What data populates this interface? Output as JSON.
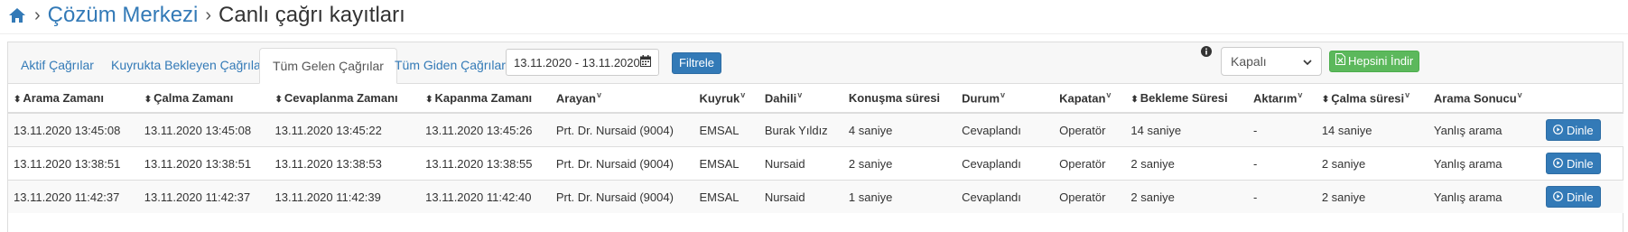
{
  "breadcrumb": {
    "home_icon": "home-icon",
    "link": "Çözüm Merkezi",
    "title": "Canlı çağrı kayıtları"
  },
  "tabs": [
    {
      "label": "Aktif Çağrılar"
    },
    {
      "label": "Kuyrukta Bekleyen Çağrılar"
    },
    {
      "label": "Tüm Gelen Çağrılar"
    },
    {
      "label": "Tüm Giden Çağrılar"
    }
  ],
  "active_tab": "Tüm Gelen Çağrılar",
  "date_range": {
    "value": "13.11.2020 - 13.11.2020"
  },
  "filter_button": "Filtrele",
  "select": {
    "value": "Kapalı"
  },
  "download_button": "Hepsini İndir",
  "columns": [
    {
      "label": "Arama Zamanı",
      "sort": true
    },
    {
      "label": "Çalma Zamanı",
      "sort": true
    },
    {
      "label": "Cevaplanma Zamanı",
      "sort": true
    },
    {
      "label": "Kapanma Zamanı",
      "sort": true
    },
    {
      "label": "Arayan",
      "filter": true
    },
    {
      "label": "Kuyruk",
      "filter": true
    },
    {
      "label": "Dahili",
      "filter": true
    },
    {
      "label": "Konuşma süresi"
    },
    {
      "label": "Durum",
      "filter": true
    },
    {
      "label": "Kapatan",
      "filter": true
    },
    {
      "label": "Bekleme Süresi",
      "sort": true
    },
    {
      "label": "Aktarım",
      "filter": true
    },
    {
      "label": "Çalma süresi",
      "sort": true,
      "filter": true
    },
    {
      "label": "Arama Sonucu",
      "filter": true
    },
    {
      "label": ""
    }
  ],
  "rows": [
    [
      "13.11.2020 13:45:08",
      "13.11.2020 13:45:08",
      "13.11.2020 13:45:22",
      "13.11.2020 13:45:26",
      "Prt. Dr. Nursaid (9004)",
      "EMSAL",
      "Burak Yıldız",
      "4 saniye",
      "Cevaplandı",
      "Operatör",
      "14 saniye",
      "-",
      "14 saniye",
      "Yanlış arama"
    ],
    [
      "13.11.2020 13:38:51",
      "13.11.2020 13:38:51",
      "13.11.2020 13:38:53",
      "13.11.2020 13:38:55",
      "Prt. Dr. Nursaid (9004)",
      "EMSAL",
      "Nursaid",
      "2 saniye",
      "Cevaplandı",
      "Operatör",
      "2 saniye",
      "-",
      "2 saniye",
      "Yanlış arama"
    ],
    [
      "13.11.2020 11:42:37",
      "13.11.2020 11:42:37",
      "13.11.2020 11:42:39",
      "13.11.2020 11:42:40",
      "Prt. Dr. Nursaid (9004)",
      "EMSAL",
      "Nursaid",
      "1 saniye",
      "Cevaplandı",
      "Operatör",
      "2 saniye",
      "-",
      "2 saniye",
      "Yanlış arama"
    ]
  ],
  "row_action": "Dinle",
  "icons": {
    "calendar": "calendar-icon",
    "info": "info-icon",
    "download": "excel-file-icon",
    "play": "play-circle-icon"
  },
  "colors": {
    "link": "#337ab7",
    "primary": "#337ab7",
    "success": "#5cb85c"
  }
}
